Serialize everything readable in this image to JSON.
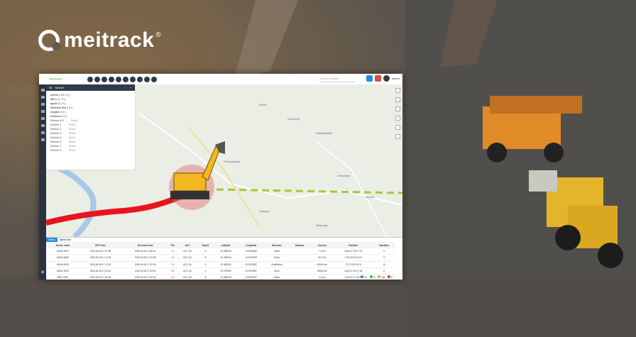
{
  "brand": {
    "logo_text": "meitrack",
    "registered": "®"
  },
  "app": {
    "brand_text": "meitrack",
    "search_placeholder": "Search a place",
    "user": "admin",
    "panel": {
      "title": "All",
      "search_placeholder": "Search",
      "groups": [
        {
          "label": "admin ( 13 / 1 )"
        },
        {
          "label": "Mini ( 1 / 1 )"
        },
        {
          "label": "apple 2 ( 2 )"
        },
        {
          "label": "MeitrackTest ( 3 )"
        },
        {
          "label": "longlive ( 0 )"
        },
        {
          "label": "Kaibodo ( 2 )"
        }
      ],
      "devices": [
        {
          "name": "Device 4G",
          "status": "Static"
        },
        {
          "name": "Device 1",
          "status": "Static"
        },
        {
          "name": "Device 2",
          "status": "Static"
        },
        {
          "name": "Device 3",
          "status": "Static"
        },
        {
          "name": "Device 5",
          "status": "Static"
        },
        {
          "name": "Device 6",
          "status": "Static"
        },
        {
          "name": "Device 7",
          "status": "Static"
        },
        {
          "name": "Device 8",
          "status": "Static"
        }
      ]
    },
    "tabs": [
      "Status",
      "Alarm Info"
    ],
    "table": {
      "headers": [
        "Device name",
        "GPS Time",
        "Received time",
        "Pin",
        "ACC",
        "Speed",
        "Latitude",
        "Longitude",
        "Direction",
        "Address",
        "Journey",
        "Runtime",
        "Satellites"
      ],
      "rows": [
        [
          "MD40-0923",
          "2025-06-18 17:57:55",
          "2025-06-18 17:58:34",
          "On",
          "ACC On",
          "0",
          "22.480054",
          "113.906263",
          "South",
          "",
          "7.0 km",
          "2024-07-06 17:22",
          "9"
        ],
        [
          "MD40-6456",
          "2025-06-18 17:12:36",
          "2025-06-18 17:12:58",
          "On",
          "ACC On",
          "8",
          "22.480054",
          "113.906263",
          "North",
          "",
          "32.3 km",
          "7-08-08 09:24:24",
          "9"
        ],
        [
          "MD40-0625",
          "2025-06-18 17:12:33",
          "2025-06-18 17:12:45",
          "On",
          "ACC On",
          "0",
          "22.480054",
          "113.909387",
          "SouthWest",
          "",
          "4008.8 km",
          "27-07-09 09:16",
          "10"
        ],
        [
          "MD41-0923",
          "2025-06-18 17:04:51",
          "2025-06-18 17:03:00",
          "Off",
          "ACC On",
          "0",
          "22.479954",
          "113.909387",
          "North",
          "",
          "23804 km",
          "1202-07-04 17:36",
          "0"
        ],
        [
          "BMU-0425",
          "2025-06-18 17:52:39",
          "2025-06-18 17:52:55",
          "On",
          "ACC On",
          "8",
          "22.480054",
          "113.906237",
          "South",
          "",
          "3.4 km",
          "3-36-02 17:36:19",
          "8"
        ]
      ]
    },
    "status_counts": [
      {
        "label": "13",
        "color": "#1d8ce0"
      },
      {
        "label": "9",
        "color": "#3bb54a"
      },
      {
        "label": "10",
        "color": "#e0a13c"
      },
      {
        "label": "2",
        "color": "#e03c3c"
      }
    ]
  },
  "map": {
    "route_color": "#e8141e",
    "dash_color": "#a3c93a"
  }
}
